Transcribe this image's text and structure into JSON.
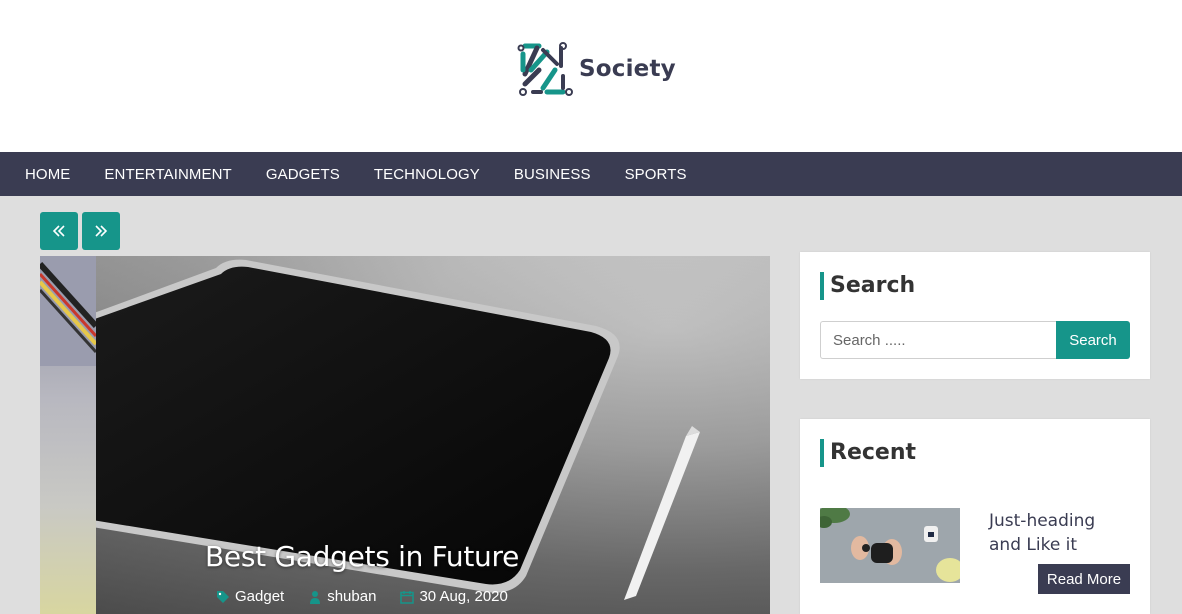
{
  "header": {
    "site_name": "Society"
  },
  "nav": {
    "items": [
      {
        "label": "HOME"
      },
      {
        "label": "ENTERTAINMENT"
      },
      {
        "label": "GADGETS"
      },
      {
        "label": "TECHNOLOGY"
      },
      {
        "label": "BUSINESS"
      },
      {
        "label": "SPORTS"
      }
    ]
  },
  "slider": {
    "prev_icon": "double-chevron-left-icon",
    "next_icon": "double-chevron-right-icon",
    "slide": {
      "title": "Best Gadgets in Future",
      "category": "Gadget",
      "author": "shuban",
      "date": "30 Aug, 2020"
    }
  },
  "sidebar": {
    "search": {
      "title": "Search",
      "placeholder": "Search .....",
      "button_label": "Search"
    },
    "recent": {
      "title": "Recent",
      "posts": [
        {
          "title": "Just-heading and Like it",
          "read_more": "Read More"
        }
      ]
    }
  },
  "colors": {
    "accent": "#16958a",
    "nav_bg": "#3a3c52",
    "page_bg": "#dedede"
  }
}
